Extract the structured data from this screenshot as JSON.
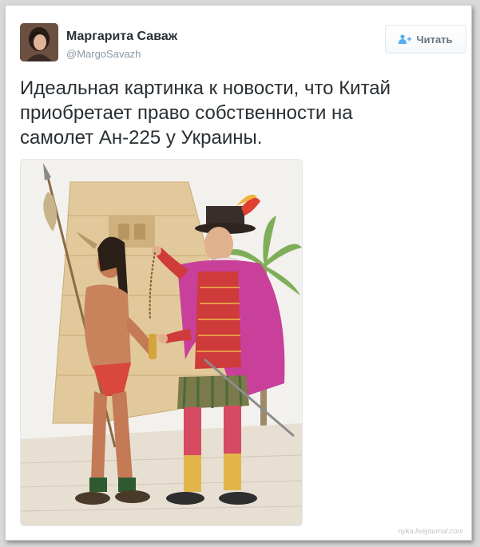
{
  "author": {
    "name": "Маргарита Саваж",
    "handle": "@MargoSavazh"
  },
  "follow_button": {
    "label": "Читать",
    "icon": "add-user-icon"
  },
  "tweet": {
    "text": "Идеальная картинка к новости, что Китай\nприобретает право собственности на\nсамолет Ан-225 у Украины."
  },
  "media": {
    "description_icon": "illustration"
  },
  "watermark": "nyka.livejournal.com",
  "colors": {
    "name": "#292f33",
    "handle": "#8899a6",
    "button_text": "#66757f",
    "icon_blue": "#55acee"
  }
}
